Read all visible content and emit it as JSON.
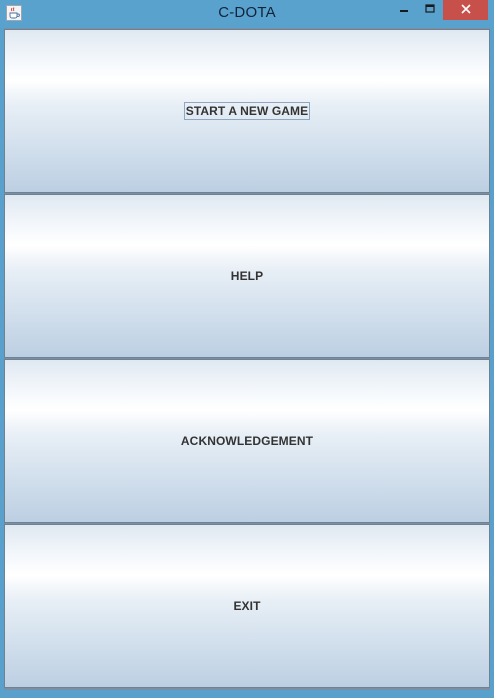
{
  "window": {
    "title": "C-DOTA",
    "controls": {
      "minimize_icon": "minimize-icon",
      "maximize_icon": "maximize-icon",
      "close_icon": "close-icon"
    },
    "app_icon": "java-coffee-cup-icon"
  },
  "menu": {
    "buttons": [
      {
        "label": "START A NEW GAME",
        "focused": true
      },
      {
        "label": "HELP",
        "focused": false
      },
      {
        "label": "ACKNOWLEDGEMENT",
        "focused": false
      },
      {
        "label": "EXIT",
        "focused": false
      }
    ]
  },
  "colors": {
    "titlebar": "#5aa2ce",
    "close_button": "#c7504a",
    "button_border": "#6f8294",
    "label_text": "#333333"
  }
}
